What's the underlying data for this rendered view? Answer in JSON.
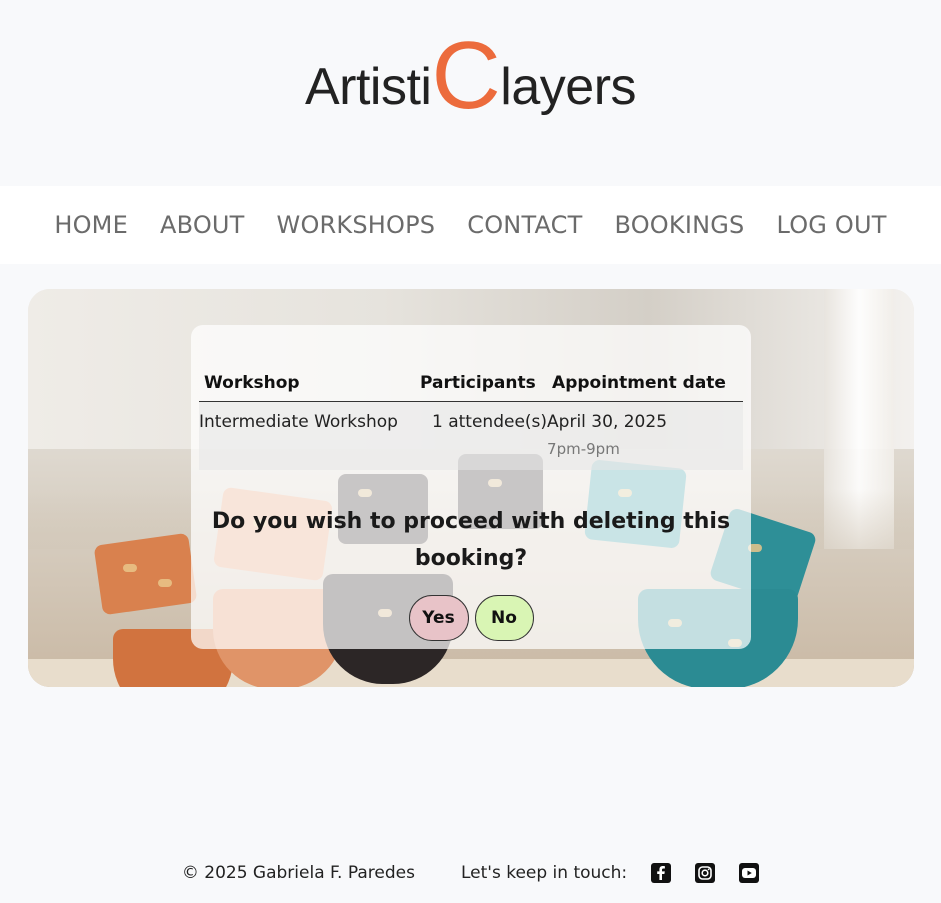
{
  "logo": {
    "part1": "Artisti",
    "big_letter": "C",
    "part2": "layers",
    "accent_color": "#ec6b3c"
  },
  "nav": {
    "items": [
      {
        "label": "HOME"
      },
      {
        "label": "ABOUT"
      },
      {
        "label": "WORKSHOPS"
      },
      {
        "label": "CONTACT"
      },
      {
        "label": "BOOKINGS"
      },
      {
        "label": "LOG OUT"
      }
    ]
  },
  "booking_table": {
    "headers": [
      "Workshop",
      "Participants",
      "Appointment date"
    ],
    "rows": [
      {
        "workshop": "Intermediate Workshop",
        "participants": "1 attendee(s)",
        "date": "April 30, 2025",
        "time": "7pm-9pm"
      }
    ]
  },
  "confirm": {
    "question": "Do you wish to proceed with deleting this booking?",
    "yes_label": "Yes",
    "no_label": "No",
    "yes_color": "#e8c3c8",
    "no_color": "#d9f5b4"
  },
  "footer": {
    "copyright": "© 2025 Gabriela F. Paredes",
    "touch_label": "Let's keep in touch:",
    "social_icons": [
      "facebook-icon",
      "instagram-icon",
      "youtube-icon"
    ]
  }
}
